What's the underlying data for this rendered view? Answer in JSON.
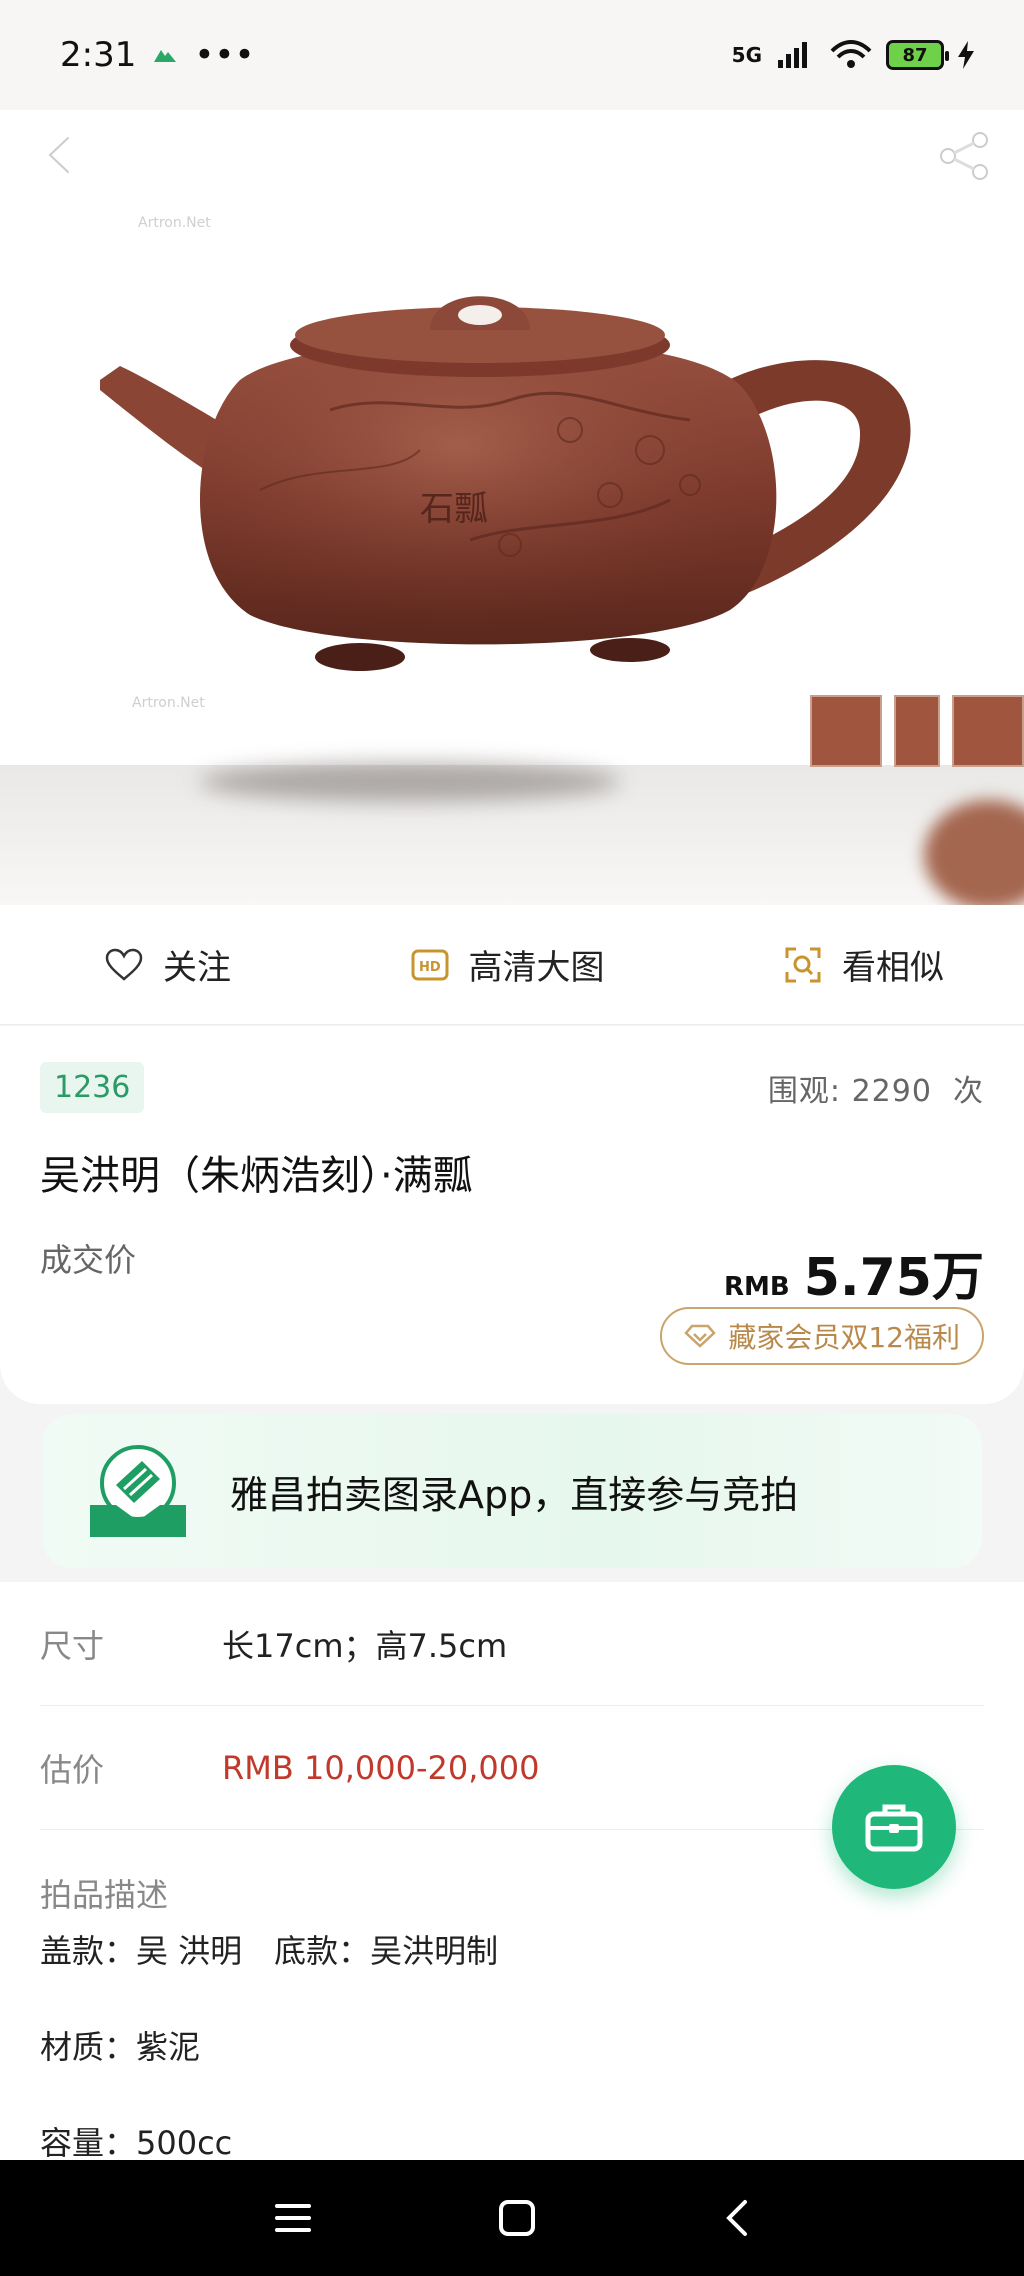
{
  "status_bar": {
    "time": "2:31",
    "dots": "•••",
    "network": "5G",
    "battery": "87"
  },
  "hero": {
    "watermark": "Artron.Net",
    "inscription": "石瓢"
  },
  "actions": [
    {
      "label": "关注",
      "icon": "heart-icon"
    },
    {
      "label": "高清大图",
      "icon": "hd-icon"
    },
    {
      "label": "看相似",
      "icon": "similar-search-icon"
    }
  ],
  "lot": {
    "number": "1236",
    "views_label": "围观:",
    "views_count": "2290",
    "views_unit": "次",
    "title": "吴洪明（朱炳浩刻）·满瓢",
    "price_label": "成交价",
    "price_currency": "RMB",
    "price_value": "5.75万",
    "vip_label": "藏家会员双12福利"
  },
  "banner": {
    "text": "雅昌拍卖图录App，直接参与竞拍"
  },
  "details": {
    "size_label": "尺寸",
    "size_value": "长17cm；高7.5cm",
    "estimate_label": "估价",
    "estimate_value": "RMB  10,000-20,000",
    "desc_title": "拍品描述",
    "desc_lines": [
      "盖款：吴 洪明　底款：吴洪明制",
      "材质：紫泥",
      "容量：500cc"
    ]
  },
  "colors": {
    "accent": "#1fb87a",
    "price_red": "#c0392b",
    "gold": "#c9a46b"
  }
}
